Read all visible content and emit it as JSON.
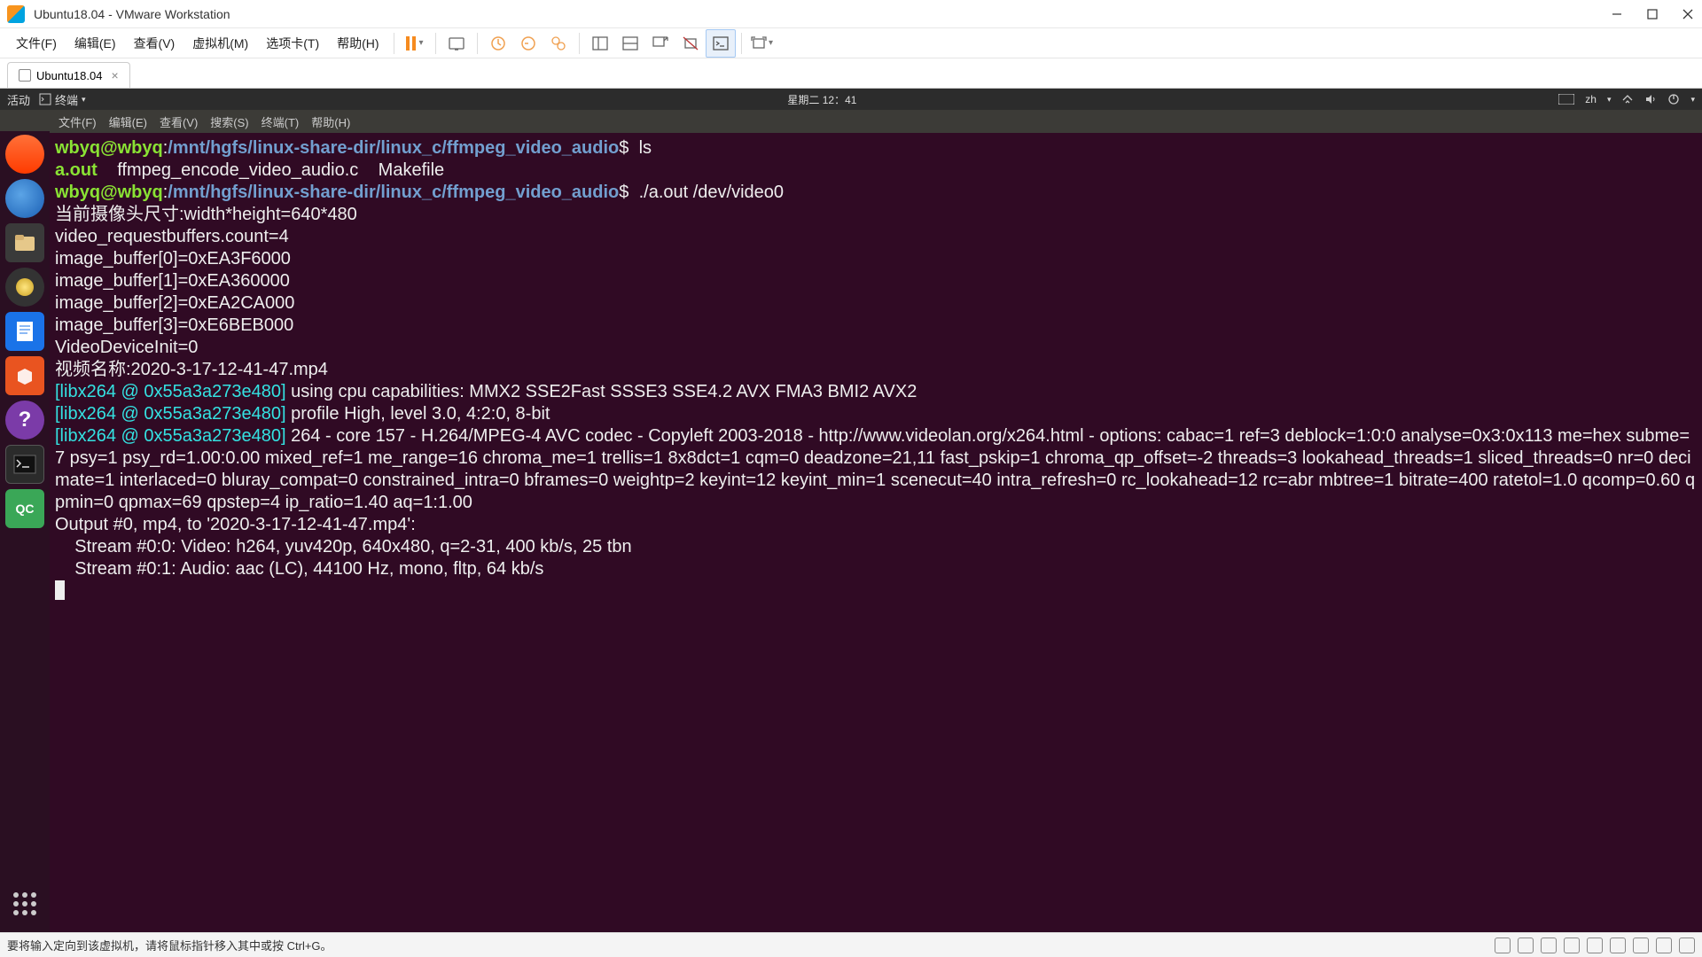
{
  "titlebar": {
    "title": "Ubuntu18.04 - VMware Workstation"
  },
  "menubar": {
    "file": "文件(F)",
    "edit": "编辑(E)",
    "view": "查看(V)",
    "vm": "虚拟机(M)",
    "tabs": "选项卡(T)",
    "help": "帮助(H)"
  },
  "tab": {
    "label": "Ubuntu18.04"
  },
  "ubuntu_topbar": {
    "activities": "活动",
    "terminal": "终端",
    "clock": "星期二 12：41",
    "lang": "zh"
  },
  "term_title": "wbyq@wbyq: /mnt/hgfs/linux-share-dir/linux_c/ffmpeg_video_audio",
  "term_menu": {
    "file": "文件(F)",
    "edit": "编辑(E)",
    "view": "查看(V)",
    "search": "搜索(S)",
    "terminal": "终端(T)",
    "help": "帮助(H)"
  },
  "prompt": {
    "user": "wbyq@wbyq",
    "sep": ":",
    "path": "/mnt/hgfs/linux-share-dir/linux_c/ffmpeg_video_audio",
    "end": "$"
  },
  "cmd1": "ls",
  "ls_out": {
    "aout": "a.out",
    "src": "ffmpeg_encode_video_audio.c",
    "make": "Makefile"
  },
  "cmd2": "./a.out /dev/video0",
  "lines": {
    "l1": "当前摄像头尺寸:width*height=640*480",
    "l2": "video_requestbuffers.count=4",
    "l3": "image_buffer[0]=0xEA3F6000",
    "l4": "image_buffer[1]=0xEA360000",
    "l5": "image_buffer[2]=0xEA2CA000",
    "l6": "image_buffer[3]=0xE6BEB000",
    "l7": "VideoDeviceInit=0",
    "l8": "视频名称:2020-3-17-12-41-47.mp4"
  },
  "libtag": "[libx264 @ 0x55a3a273e480]",
  "libx": {
    "a": " using cpu capabilities: MMX2 SSE2Fast SSSE3 SSE4.2 AVX FMA3 BMI2 AVX2",
    "b": " profile High, level 3.0, 4:2:0, 8-bit",
    "c": " 264 - core 157 - H.264/MPEG-4 AVC codec - Copyleft 2003-2018 - http://www.videolan.org/x264.html - options: cabac=1 ref=3 deblock=1:0:0 analyse=0x3:0x113 me=hex subme=7 psy=1 psy_rd=1.00:0.00 mixed_ref=1 me_range=16 chroma_me=1 trellis=1 8x8dct=1 cqm=0 deadzone=21,11 fast_pskip=1 chroma_qp_offset=-2 threads=3 lookahead_threads=1 sliced_threads=0 nr=0 decimate=1 interlaced=0 bluray_compat=0 constrained_intra=0 bframes=0 weightp=2 keyint=12 keyint_min=1 scenecut=40 intra_refresh=0 rc_lookahead=12 rc=abr mbtree=1 bitrate=400 ratetol=1.0 qcomp=0.60 qpmin=0 qpmax=69 qpstep=4 ip_ratio=1.40 aq=1:1.00"
  },
  "out": {
    "h": "Output #0, mp4, to '2020-3-17-12-41-47.mp4':",
    "s0": "    Stream #0:0: Video: h264, yuv420p, 640x480, q=2-31, 400 kb/s, 25 tbn",
    "s1": "    Stream #0:1: Audio: aac (LC), 44100 Hz, mono, fltp, 64 kb/s"
  },
  "statusbar": {
    "hint": "要将输入定向到该虚拟机，请将鼠标指针移入其中或按 Ctrl+G。"
  }
}
